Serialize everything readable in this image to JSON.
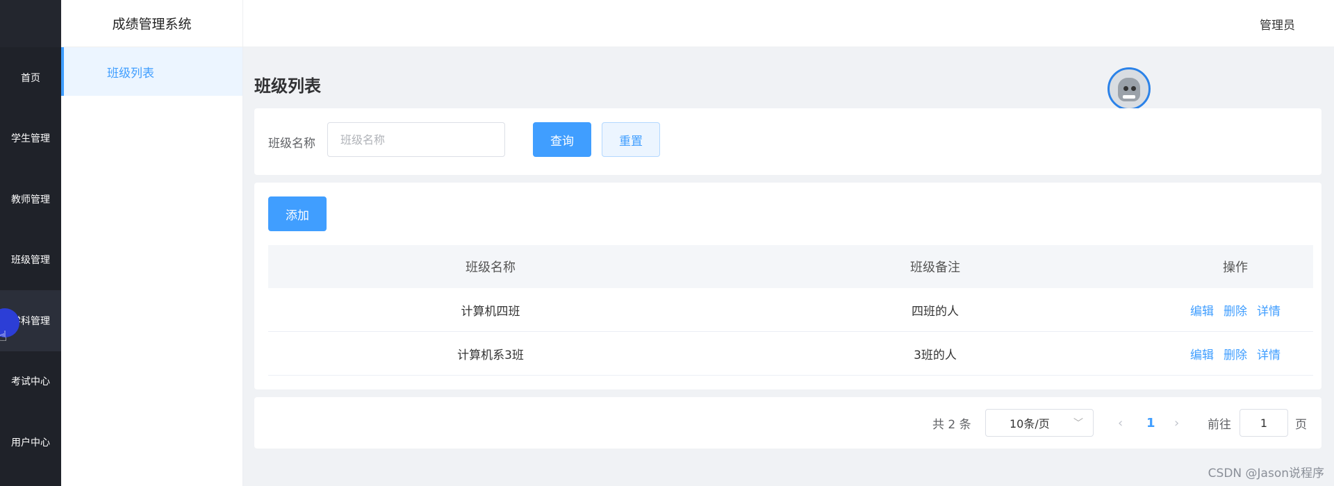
{
  "rail": {
    "items": [
      {
        "label": "首页"
      },
      {
        "label": "学生管理"
      },
      {
        "label": "教师管理"
      },
      {
        "label": "班级管理"
      },
      {
        "label": "学科管理"
      },
      {
        "label": "考试中心"
      },
      {
        "label": "用户中心"
      }
    ],
    "active_index": 4
  },
  "app_title": "成绩管理系统",
  "submenu": {
    "items": [
      {
        "label": "班级列表"
      }
    ]
  },
  "header": {
    "user": "管理员"
  },
  "page_title": "班级列表",
  "search": {
    "label": "班级名称",
    "placeholder": "班级名称",
    "query_label": "查询",
    "reset_label": "重置"
  },
  "toolbar": {
    "add_label": "添加"
  },
  "table": {
    "headers": {
      "name": "班级名称",
      "remark": "班级备注",
      "operations": "操作"
    },
    "rows": [
      {
        "name": "计算机四班",
        "remark": "四班的人"
      },
      {
        "name": "计算机系3班",
        "remark": "3班的人"
      }
    ],
    "actions": {
      "edit": "编辑",
      "delete": "删除",
      "detail": "详情"
    }
  },
  "pagination": {
    "total_text": "共 2 条",
    "page_size": "10条/页",
    "current_page": "1",
    "goto_label": "前往",
    "goto_value": "1",
    "page_suffix": "页"
  },
  "watermark": "CSDN @Jason说程序",
  "colors": {
    "primary": "#409eff",
    "rail_bg": "#1f2229",
    "page_bg": "#f0f2f5"
  }
}
